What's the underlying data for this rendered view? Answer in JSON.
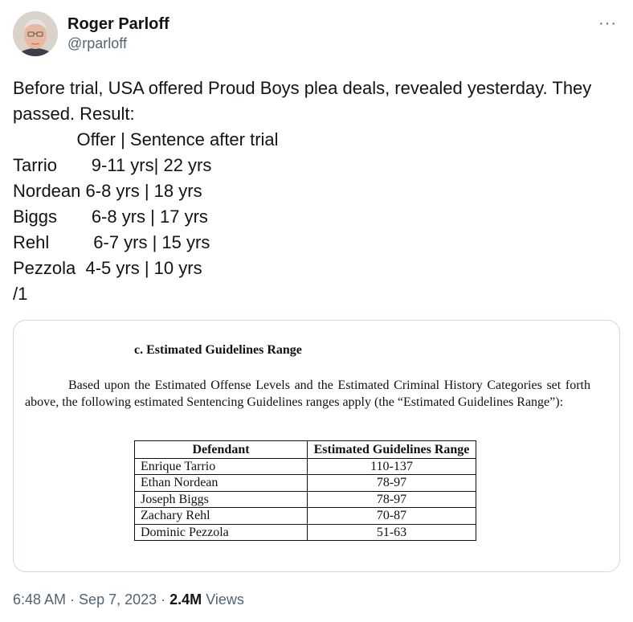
{
  "author": {
    "display_name": "Roger Parloff",
    "handle": "@rparloff"
  },
  "more_label": "···",
  "tweet_lines": [
    "Before trial, USA offered Proud Boys plea deals, revealed yesterday. They",
    "passed. Result:",
    "             Offer | Sentence after trial",
    "Tarrio       9-11 yrs| 22 yrs",
    "Nordean 6-8 yrs | 18 yrs",
    "Biggs       6-8 yrs | 17 yrs",
    "Rehl         6-7 yrs | 15 yrs",
    "Pezzola  4-5 yrs | 10 yrs",
    "/1"
  ],
  "document": {
    "heading": "c.   Estimated Guidelines Range",
    "paragraph": "Based upon the Estimated Offense Levels and the Estimated Criminal History Categories set forth above, the following estimated Sentencing Guidelines ranges apply (the “Estimated Guidelines Range”):",
    "table": {
      "headers": [
        "Defendant",
        "Estimated Guidelines Range"
      ],
      "rows": [
        [
          "Enrique Tarrio",
          "110-137"
        ],
        [
          "Ethan Nordean",
          "78-97"
        ],
        [
          "Joseph Biggs",
          "78-97"
        ],
        [
          "Zachary Rehl",
          "70-87"
        ],
        [
          "Dominic Pezzola",
          "51-63"
        ]
      ]
    }
  },
  "footer": {
    "time": "6:48 AM",
    "separator": " · ",
    "date": "Sep 7, 2023",
    "views_count": "2.4M",
    "views_label": "Views"
  }
}
